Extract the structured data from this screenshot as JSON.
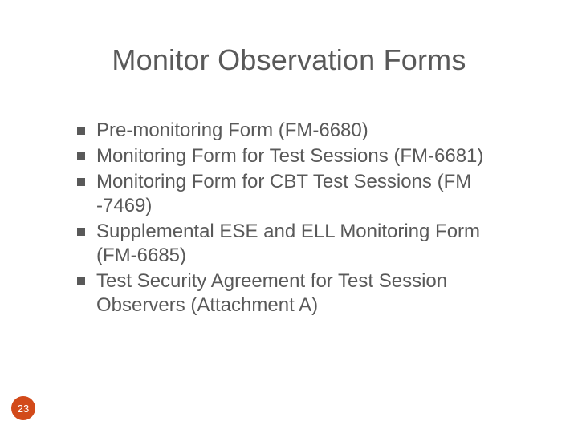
{
  "title": "Monitor Observation Forms",
  "items": [
    {
      "text": "Pre-monitoring Form (FM-6680)"
    },
    {
      "text": "Monitoring Form for Test Sessions (FM-6681)"
    },
    {
      "text": "Monitoring Form for CBT Test Sessions       (FM -7469)"
    },
    {
      "text": "Supplemental ESE and ELL Monitoring Form (FM-6685)"
    },
    {
      "text": "Test Security Agreement for Test Session Observers (Attachment A)"
    }
  ],
  "page_number": "23"
}
